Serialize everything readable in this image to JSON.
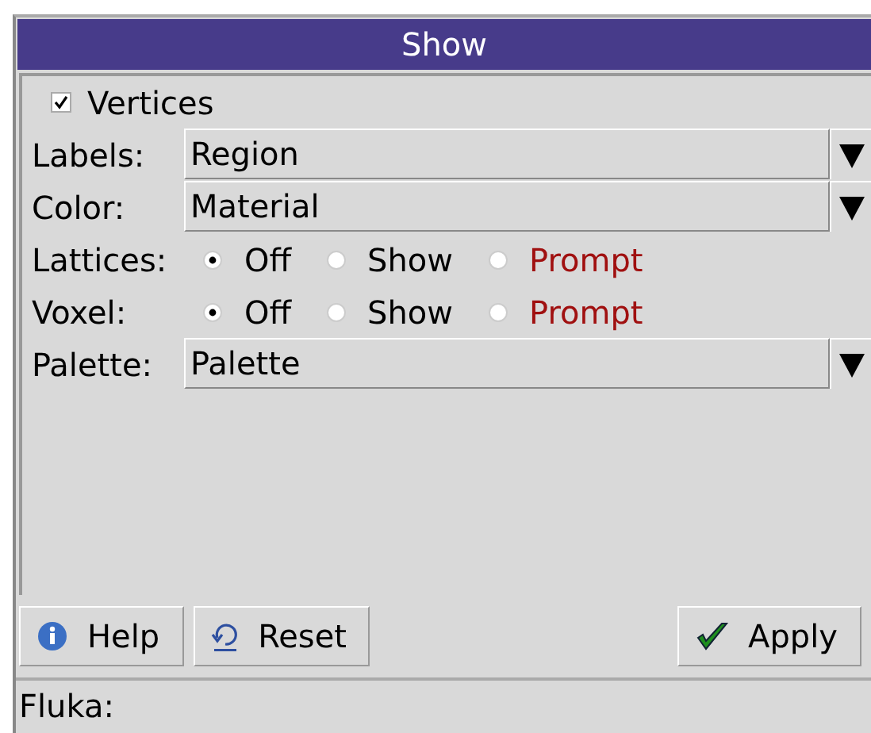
{
  "window": {
    "title": "Show"
  },
  "rows": [
    {
      "kind": "checkbox",
      "label": "Vertices",
      "checked": true
    },
    {
      "kind": "combo",
      "label": "Labels:",
      "value": "Region"
    },
    {
      "kind": "combo",
      "label": "Color:",
      "value": "Material"
    },
    {
      "kind": "radio",
      "label": "Lattices:",
      "options": [
        {
          "label": "Off",
          "selected": true,
          "color": "#000000"
        },
        {
          "label": "Show",
          "selected": false,
          "color": "#000000"
        },
        {
          "label": "Prompt",
          "selected": false,
          "color": "#a01010"
        }
      ]
    },
    {
      "kind": "radio",
      "label": "Voxel:",
      "options": [
        {
          "label": "Off",
          "selected": true,
          "color": "#000000"
        },
        {
          "label": "Show",
          "selected": false,
          "color": "#000000"
        },
        {
          "label": "Prompt",
          "selected": false,
          "color": "#a01010"
        }
      ]
    },
    {
      "kind": "combo",
      "label": "Palette:",
      "value": "Palette"
    }
  ],
  "buttons": [
    {
      "kind": "help",
      "label": "Help"
    },
    {
      "kind": "reset",
      "label": "Reset"
    },
    {
      "kind": "apply",
      "label": "Apply"
    }
  ],
  "status_bar": {
    "text": "Fluka:"
  }
}
